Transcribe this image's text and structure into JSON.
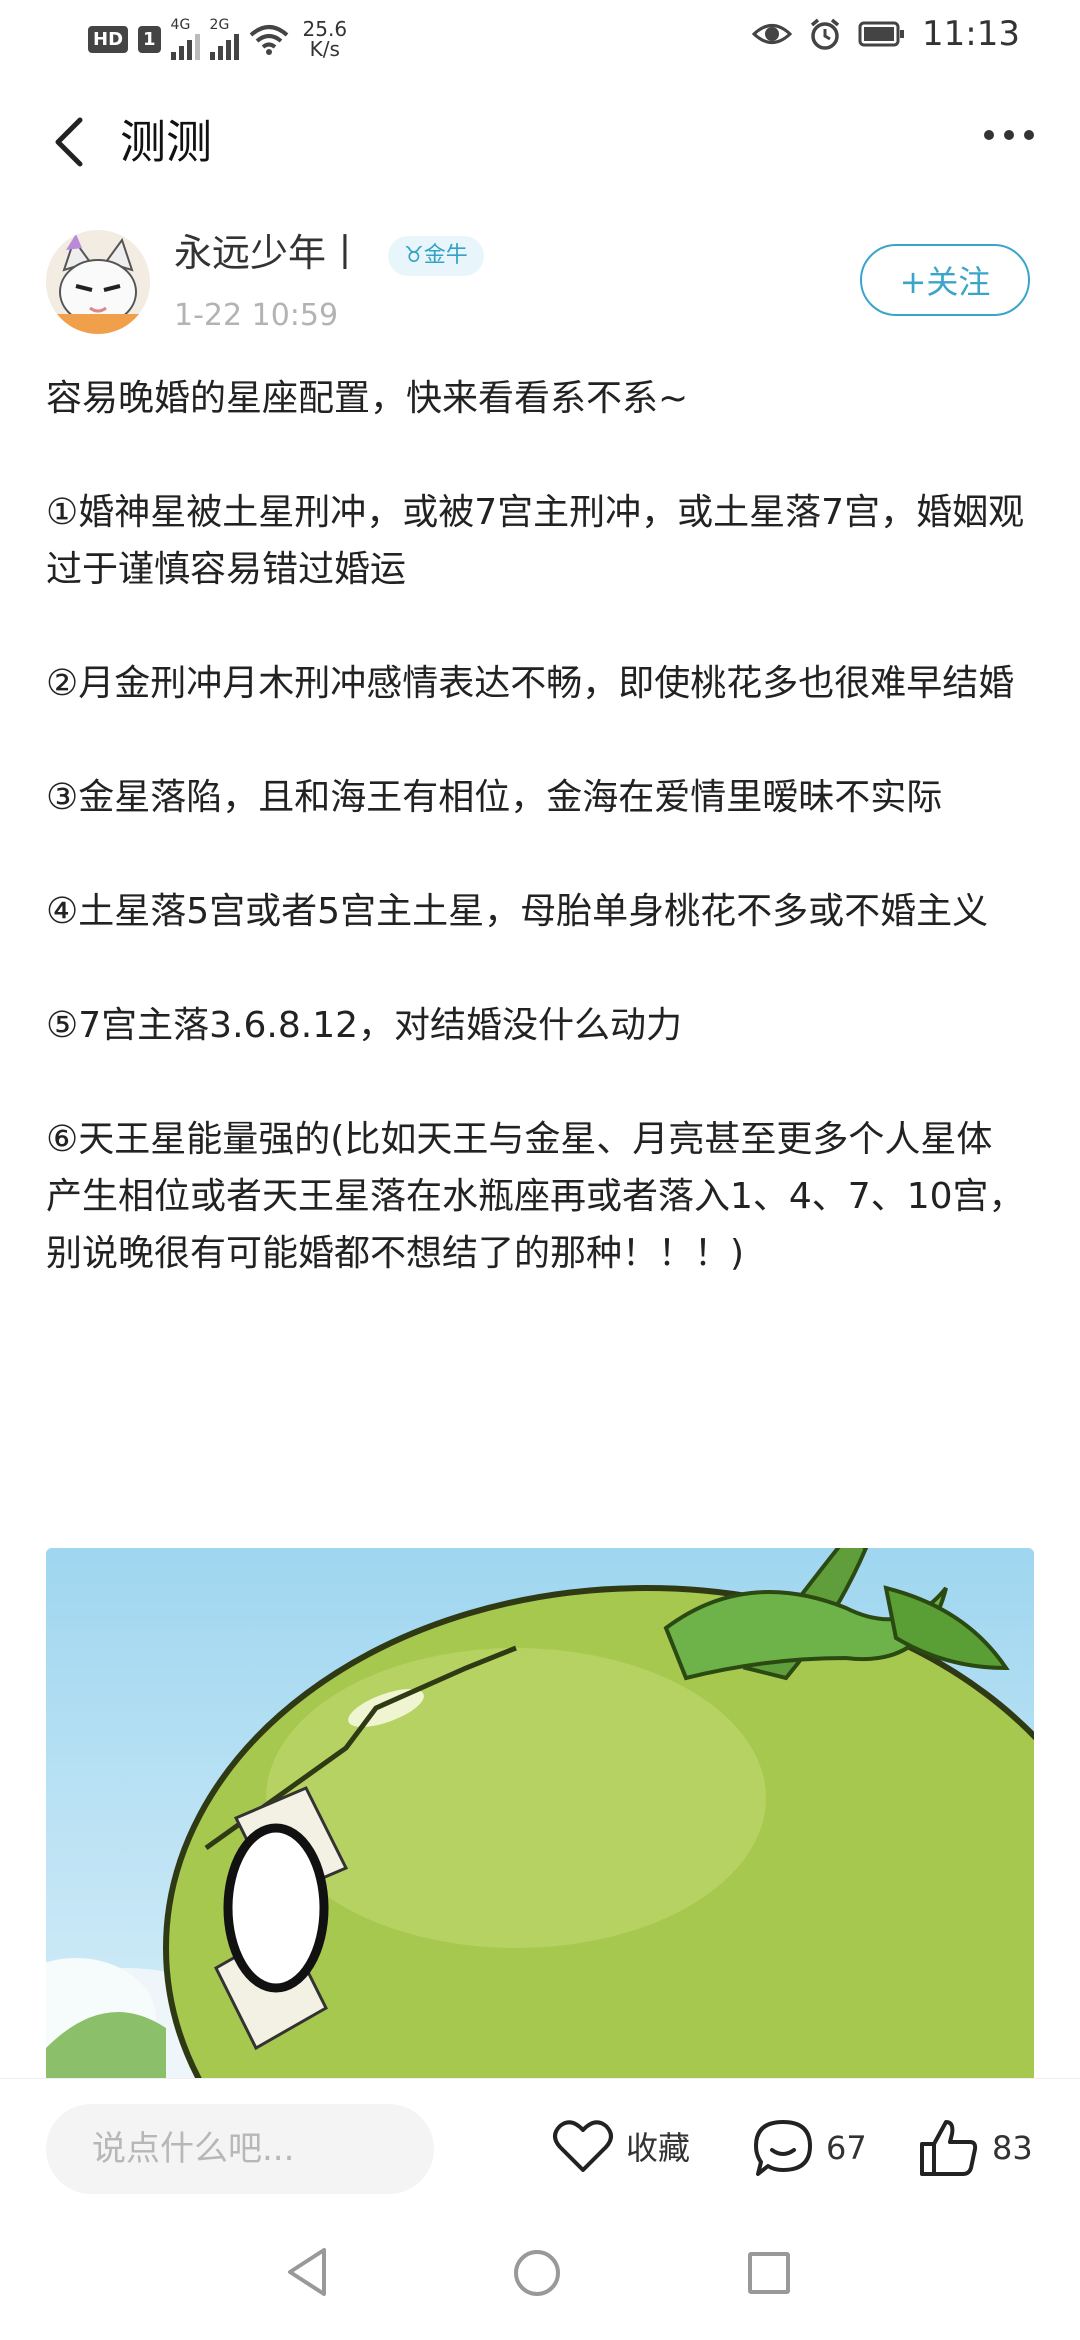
{
  "status_bar": {
    "hd_label": "HD",
    "net_left": "4G",
    "net_right": "2G",
    "speed_value": "25.6",
    "speed_unit": "K/s",
    "time": "11:13",
    "icons": [
      "eye-icon",
      "alarm-icon",
      "battery-icon"
    ]
  },
  "header": {
    "title": "测测"
  },
  "author": {
    "name": "永远少年丨",
    "zodiac": "♉金牛",
    "time": "1-22 10:59",
    "follow_label": "+关注"
  },
  "post": {
    "paragraphs": [
      "容易晚婚的星座配置，快来看看系不系~",
      "①婚神星被土星刑冲，或被7宫主刑冲，或土星落7宫，婚姻观过于谨慎容易错过婚运",
      "②月金刑冲月木刑冲感情表达不畅，即使桃花多也很难早结婚",
      "③金星落陷，且和海王有相位，金海在爱情里暧昧不实际",
      "④土星落5宫或者5宫主土星，母胎单身桃花不多或不婚主义",
      "⑤7宫主落3.6.8.12，对结婚没什么动力",
      "⑥天王星能量强的(比如天王与金星、月亮甚至更多个人星体产生相位或者天王星落在水瓶座再或者落入1、4、7、10宫，别说晚很有可能婚都不想结了的那种！！！)"
    ]
  },
  "bottom_bar": {
    "comment_placeholder": "说点什么吧...",
    "favorite_label": "收藏",
    "comment_count": "67",
    "like_count": "83"
  }
}
